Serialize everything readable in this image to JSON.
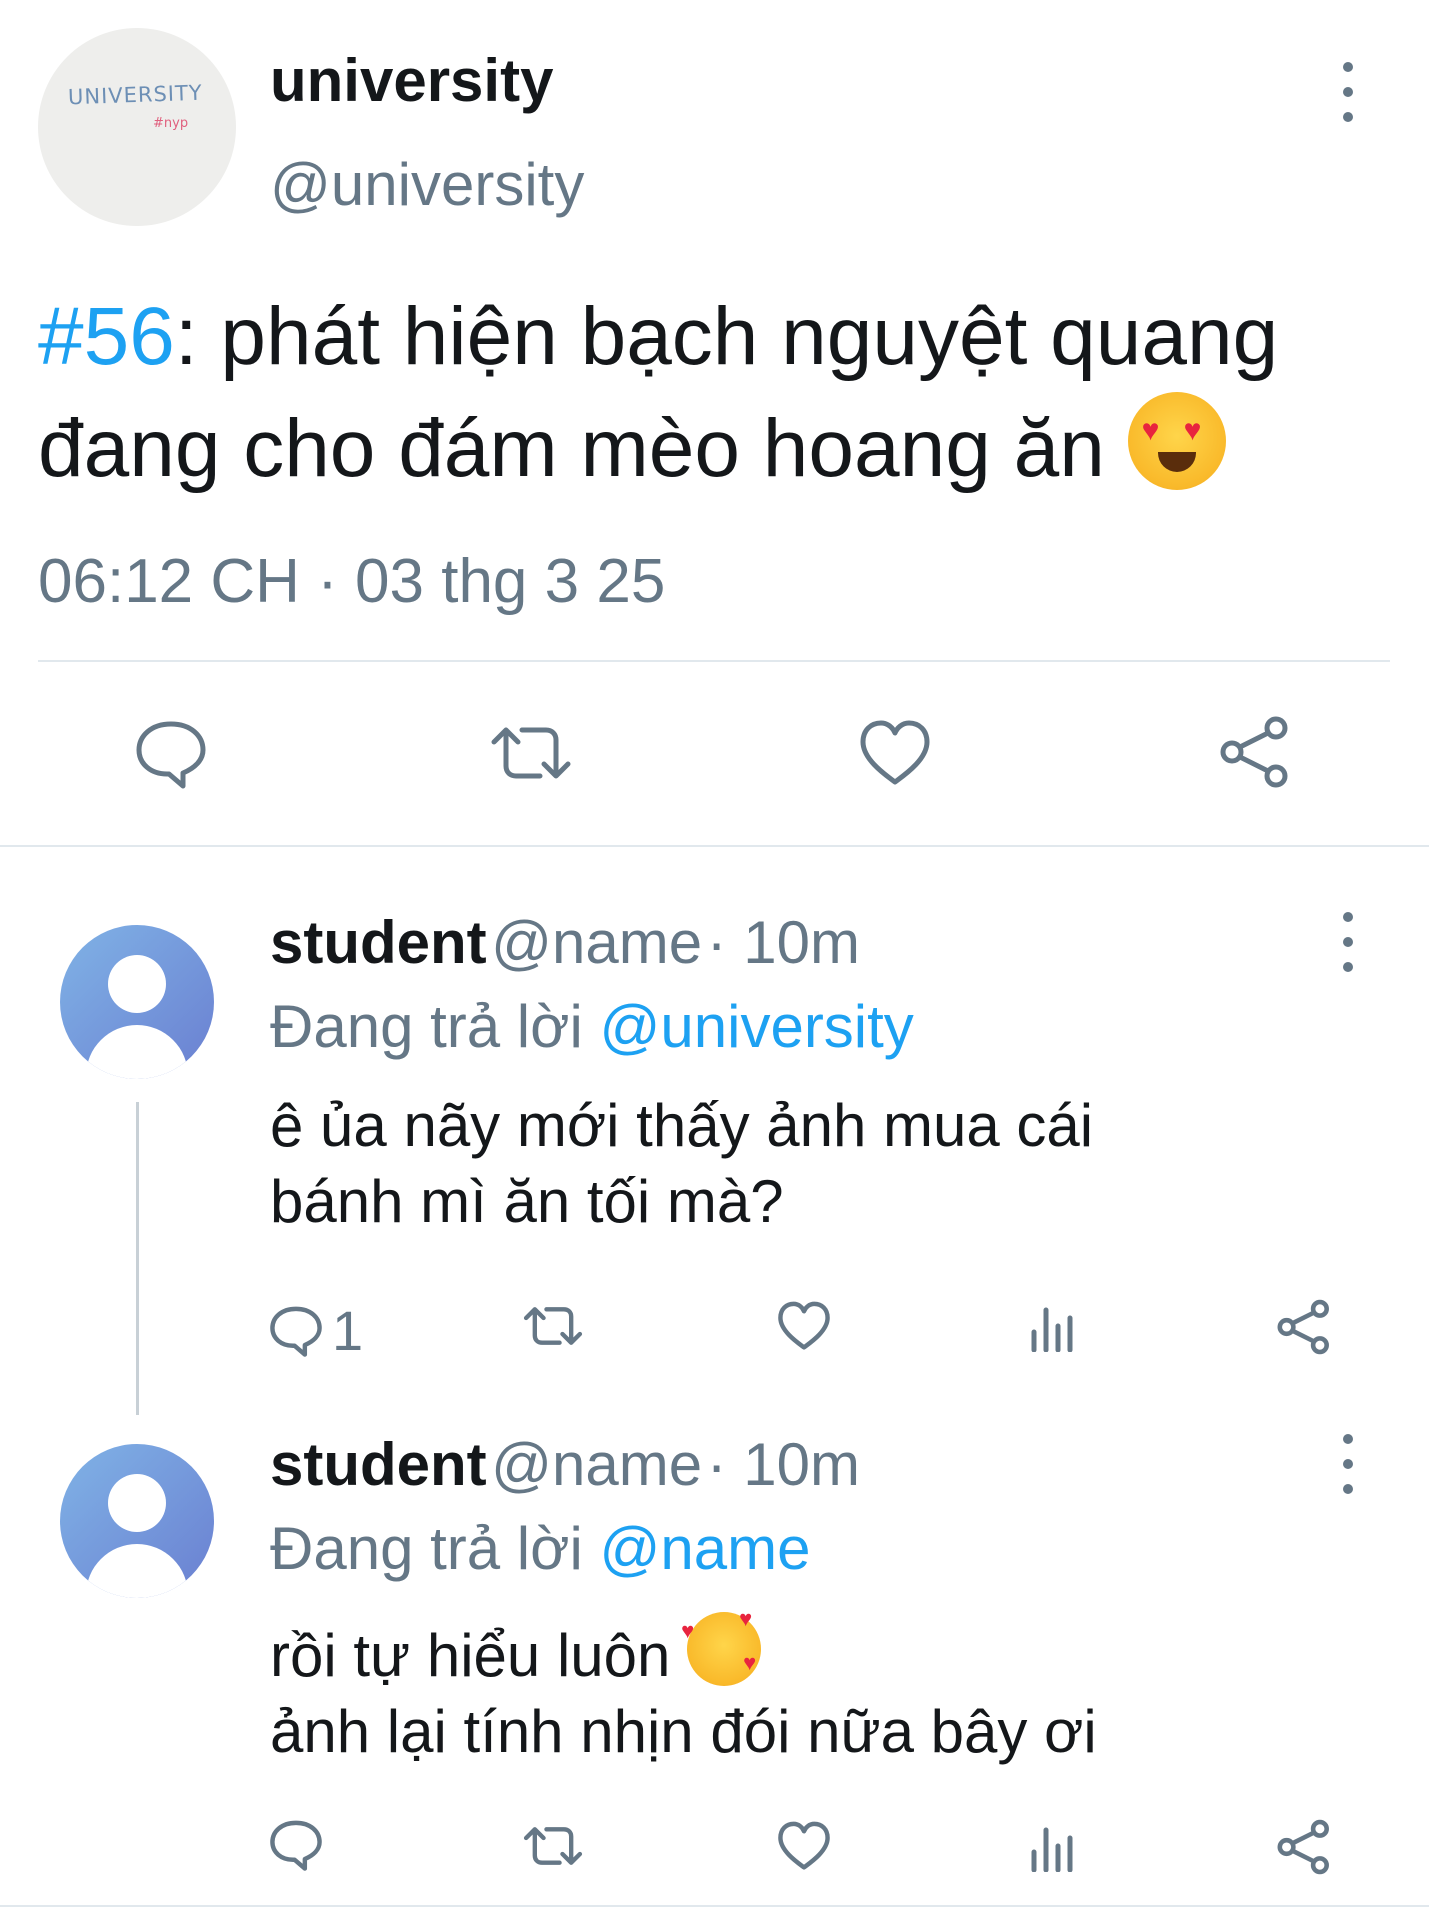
{
  "tweet": {
    "avatar_text_line1": "UNIVERSITY",
    "avatar_text_line2": "#nyp",
    "name": "university",
    "handle": "@university",
    "hashtag": "#56",
    "text": ": phát hiện bạch nguyệt quang đang cho đám mèo hoang ăn",
    "emoji": "heart-eyes-emoji",
    "timestamp": "06:12 CH · 03 thg 3 25",
    "actions": [
      "reply-icon",
      "retweet-icon",
      "like-icon",
      "share-icon"
    ]
  },
  "replies": [
    {
      "name": "student",
      "handle": "@name",
      "time": "· 10m",
      "replying_prefix": "Đang trả lời",
      "replying_to": "@university",
      "text_line1": "ê ủa nãy mới thấy ảnh mua cái",
      "text_line2": "bánh mì ăn tối mà?",
      "reply_count": "1",
      "actions": [
        "reply-icon",
        "retweet-icon",
        "like-icon",
        "analytics-icon",
        "share-icon"
      ]
    },
    {
      "name": "student",
      "handle": "@name",
      "time": "· 10m",
      "replying_prefix": "Đang trả lời",
      "replying_to": "@name",
      "text_line1": "rồi tự hiểu luôn",
      "text_line2": "ảnh lại tính nhịn đói nữa bây ơi",
      "emoji": "smiling-face-with-hearts-emoji",
      "actions": [
        "reply-icon",
        "retweet-icon",
        "like-icon",
        "analytics-icon",
        "share-icon"
      ]
    }
  ],
  "colors": {
    "accent": "#1da1f2",
    "secondary_text": "#657786",
    "divider": "#e1e8ed"
  }
}
